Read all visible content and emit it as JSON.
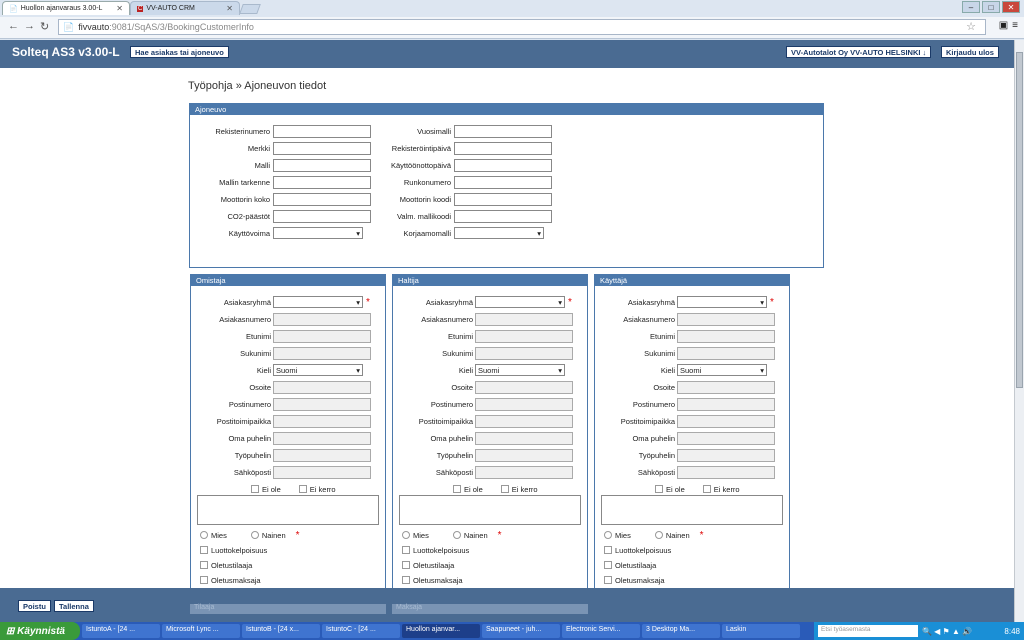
{
  "browser": {
    "tabs": [
      {
        "title": "Huollon ajanvaraus 3.00-L",
        "active": true
      },
      {
        "title": "VV-AUTO CRM",
        "active": false
      }
    ],
    "url_host": "fivvauto",
    "url_path": ":9081/SqAS/3/BookingCustomerInfo"
  },
  "app": {
    "brand": "Solteq AS3 v3.00-L",
    "search_button": "Hae asiakas tai ajoneuvo",
    "company_button": "VV-Autotalot Oy VV-AUTO HELSINKI",
    "logout_button": "Kirjaudu ulos"
  },
  "breadcrumb": "Työpohja » Ajoneuvon tiedot",
  "vehicle": {
    "title": "Ajoneuvo",
    "left": [
      "Rekisterinumero",
      "Merkki",
      "Malli",
      "Mallin tarkenne",
      "Moottorin koko",
      "CO2-päästöt",
      "Käyttövoima"
    ],
    "right": [
      "Vuosimalli",
      "Rekisteröintipäivä",
      "Käyttöönottopäivä",
      "Runkonumero",
      "Moottorin koodi",
      "Valm. mallikoodi",
      "Korjaamomalli"
    ]
  },
  "persons": [
    {
      "title": "Omistaja"
    },
    {
      "title": "Haltija"
    },
    {
      "title": "Käyttäjä"
    }
  ],
  "person_fields": [
    "Asiakasryhmä",
    "Asiakasnumero",
    "Etunimi",
    "Sukunimi",
    "Kieli",
    "Osoite",
    "Postinumero",
    "Postitoimipaikka",
    "Oma puhelin",
    "Työpuhelin",
    "Sähköposti"
  ],
  "language_value": "Suomi",
  "ei_ole": "Ei ole",
  "ei_kerro": "Ei kerro",
  "gender": {
    "male": "Mies",
    "female": "Nainen"
  },
  "checkboxes": [
    "Luottokelpoisuus",
    "Oletustilaaja",
    "Oletusmaksaja"
  ],
  "footer": {
    "remove": "Poistu",
    "save": "Tallenna",
    "ghost1": "Tilaaja",
    "ghost2": "Maksaja"
  },
  "taskbar": {
    "start": "Käynnistä",
    "items": [
      "IstuntoA - [24 ...",
      "Microsoft Lync ...",
      "IstuntoB - [24 x...",
      "IstuntoC - [24 ...",
      "Huollon ajanvar...",
      "Saapuneet - juh...",
      "Electronic Servi...",
      "3 Desktop Ma...",
      "Laskin"
    ],
    "search_placeholder": "Etsi työasemasta",
    "clock": "8:48"
  }
}
